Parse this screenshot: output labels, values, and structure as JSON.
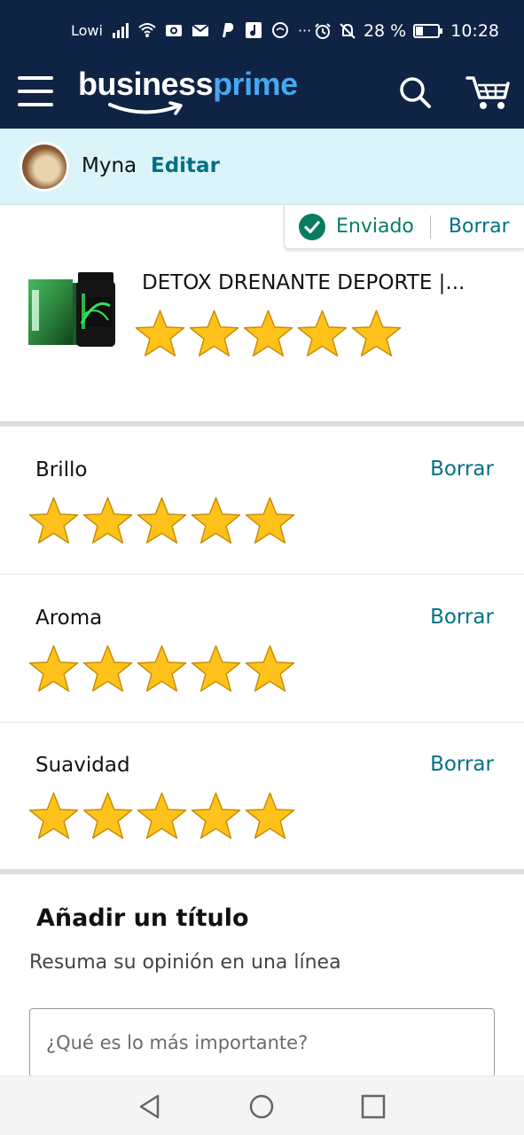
{
  "status_bar": {
    "carrier": "Lowi",
    "battery": "28 %",
    "time": "10:28",
    "more": "···"
  },
  "header": {
    "logo_word1": "business",
    "logo_word2": "prime",
    "colors": {
      "background": "#0f2345",
      "prime": "#48a7ef"
    }
  },
  "user": {
    "name": "Myna",
    "edit_label": "Editar"
  },
  "submission": {
    "status": "Enviado",
    "delete_label": "Borrar"
  },
  "product": {
    "title": "DETOX DRENANTE DEPORTE |...",
    "rating": 5,
    "max_rating": 5
  },
  "attributes": [
    {
      "label": "Brillo",
      "delete_label": "Borrar",
      "rating": 5
    },
    {
      "label": "Aroma",
      "delete_label": "Borrar",
      "rating": 5
    },
    {
      "label": "Suavidad",
      "delete_label": "Borrar",
      "rating": 5
    }
  ],
  "title_section": {
    "heading": "Añadir un título",
    "subtitle": "Resuma su opinión en una línea",
    "placeholder": "¿Qué es lo más importante?"
  },
  "icons": [
    "menu-icon",
    "search-icon",
    "cart-icon",
    "check-icon",
    "star-icon",
    "back-icon",
    "home-icon",
    "recents-icon"
  ],
  "colors": {
    "link": "#007185",
    "sent_green": "#067d62",
    "star": "#ffc21a",
    "userbar": "#daf4f9"
  }
}
